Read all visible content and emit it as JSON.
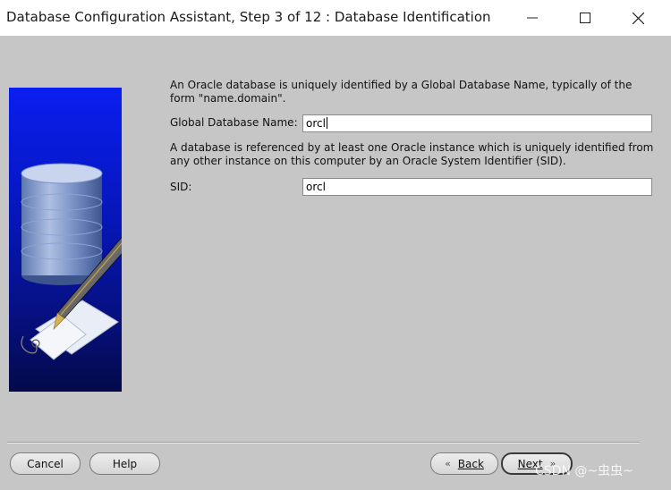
{
  "window": {
    "title": "Database Configuration Assistant, Step 3 of 12 : Database Identification"
  },
  "content": {
    "description_1": "An Oracle database is uniquely identified by a Global Database Name, typically of the form \"name.domain\".",
    "global_db_name_label": "Global Database Name:",
    "global_db_name_value": "orcl",
    "description_2": "A database is referenced by at least one Oracle instance which is uniquely identified from any other instance on this computer by an Oracle System Identifier (SID).",
    "sid_label": "SID:",
    "sid_value": "orcl"
  },
  "buttons": {
    "cancel": "Cancel",
    "help": "Help",
    "back": "Back",
    "back_icon": "«",
    "next": "Next",
    "next_icon": "»"
  },
  "watermark": "CSDN @~虫虫~",
  "icons": [
    "minimize-icon",
    "maximize-icon",
    "close-icon",
    "database-pen-illustration"
  ],
  "colors": {
    "window_bg": "#c6c6c6",
    "banner_blue": "#0a1ef0"
  }
}
